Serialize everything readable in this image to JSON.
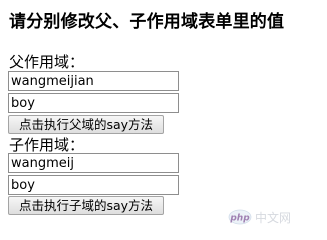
{
  "page": {
    "title": "请分别修改父、子作用域表单里的值"
  },
  "parent_scope": {
    "label": "父作用域：",
    "field1_value": "wangmeijian",
    "field2_value": "boy",
    "button_label": "点击执行父域的say方法"
  },
  "child_scope": {
    "label": "子作用域：",
    "field1_value": "wangmeij",
    "field2_value": "boy",
    "button_label": "点击执行子域的say方法"
  },
  "watermark": {
    "text": "php中文网"
  }
}
